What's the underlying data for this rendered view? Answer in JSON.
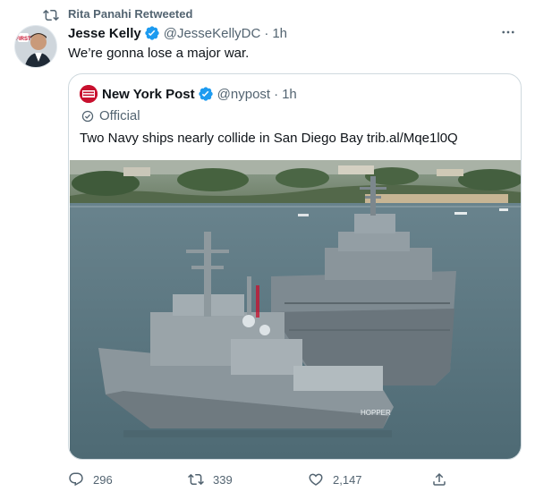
{
  "retweet": {
    "label": "Rita Panahi Retweeted",
    "icon": "retweet-icon"
  },
  "tweet": {
    "author_name": "Jesse Kelly",
    "handle": "@JesseKellyDC",
    "separator": "·",
    "time": "1h",
    "text": "We’re gonna lose a major war.",
    "verified_icon": "verified-badge-icon",
    "more_icon": "more-icon"
  },
  "quote": {
    "author_name": "New York Post",
    "handle": "@nypost",
    "separator": "·",
    "time": "1h",
    "official_label": "Official",
    "text": "Two Navy ships nearly collide in San Diego Bay trib.al/Mqe1l0Q",
    "media_alt": "Two Navy ships in San Diego Bay",
    "logo_text": "NEW YORK POST",
    "hull_number": "HOPPER"
  },
  "actions": {
    "replies": "296",
    "retweets": "339",
    "likes": "2,147"
  },
  "colors": {
    "accent": "#1d9bf0",
    "secondary_text": "#536471",
    "border": "#cfd9de",
    "nypost_red": "#c8102e"
  }
}
